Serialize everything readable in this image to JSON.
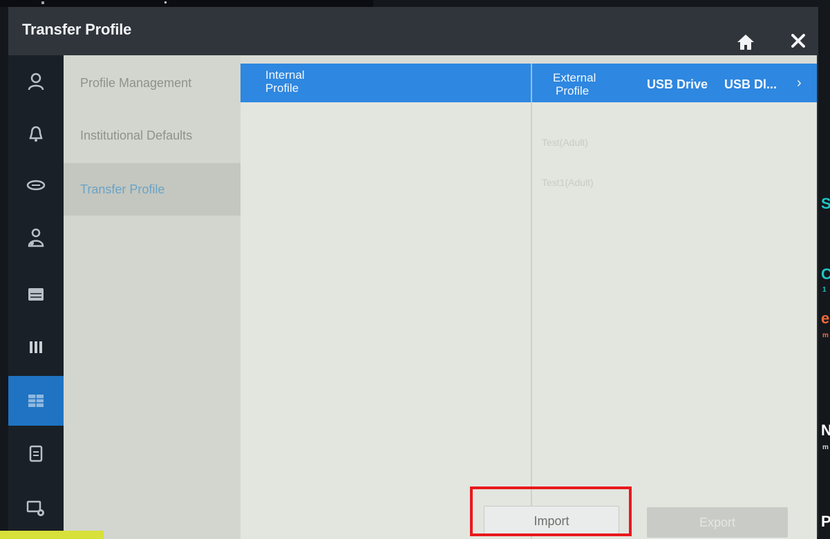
{
  "dialog": {
    "title": "Transfer Profile"
  },
  "rail": {
    "items": [
      {
        "icon": "user-icon"
      },
      {
        "icon": "bell-icon"
      },
      {
        "icon": "lungs-icon"
      },
      {
        "icon": "patient-icon"
      },
      {
        "icon": "monitor-icon"
      },
      {
        "icon": "bars-icon"
      },
      {
        "icon": "table-icon",
        "active": true
      },
      {
        "icon": "clipboard-icon"
      },
      {
        "icon": "screen-settings-icon"
      }
    ]
  },
  "subnav": {
    "items": [
      {
        "label": "Profile Management"
      },
      {
        "label": "Institutional Defaults"
      },
      {
        "label": "Transfer Profile",
        "selected": true
      }
    ]
  },
  "table": {
    "internal_header_line1": "Internal",
    "internal_header_line2": "Profile",
    "external_header_line1": "External",
    "external_header_line2": "Profile",
    "drive1": "USB Drive",
    "drive2": "USB Dl...",
    "drive2_chevron": "›",
    "external_profiles": [
      "Test(Adult)",
      "Test1(Adult)"
    ]
  },
  "buttons": {
    "import": "Import",
    "export": "Export"
  },
  "edge_text": {
    "s": "S",
    "c": "C",
    "one": "1",
    "e": "e",
    "m1": "m",
    "n": "N",
    "m2": "m",
    "p": "P"
  },
  "colors": {
    "accent": "#1f73c2",
    "header": "#2e87e0",
    "highlight": "#e8191c"
  }
}
